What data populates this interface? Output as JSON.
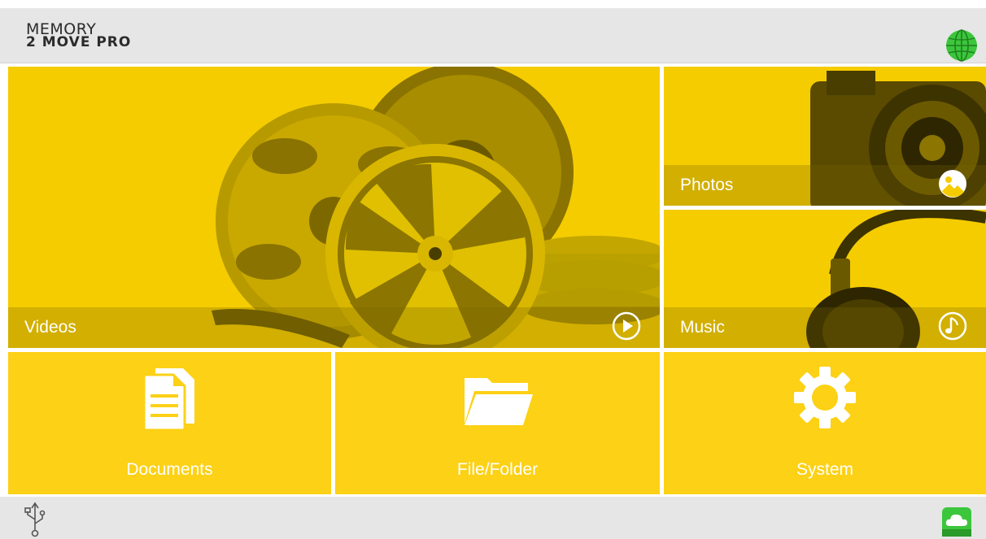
{
  "app": {
    "logo_line1": "MEMORY",
    "logo_line2": "2 MOVE PRO"
  },
  "tiles": {
    "videos": {
      "label": "Videos",
      "icon": "play-circle-icon"
    },
    "photos": {
      "label": "Photos",
      "icon": "photo-icon"
    },
    "music": {
      "label": "Music",
      "icon": "music-note-icon"
    },
    "documents": {
      "label": "Documents",
      "icon": "documents-icon"
    },
    "files": {
      "label": "File/Folder",
      "icon": "folder-icon"
    },
    "system": {
      "label": "System",
      "icon": "gear-icon"
    }
  },
  "status": {
    "connection_icon": "globe-icon",
    "usb_icon": "usb-icon",
    "cloud_icon": "cloud-icon"
  },
  "colors": {
    "tile_yellow": "#f5cc00",
    "bar_gray": "#e6e6e6",
    "accent_green": "#3cc63c"
  }
}
